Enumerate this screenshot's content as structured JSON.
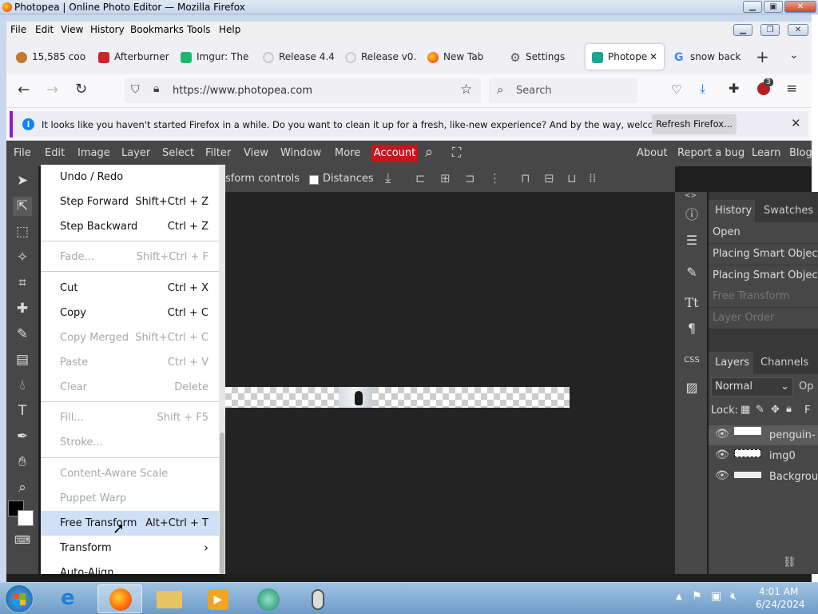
{
  "window": {
    "title": "Photopea | Online Photo Editor — Mozilla Firefox"
  },
  "firefox_menu": [
    "File",
    "Edit",
    "View",
    "History",
    "Bookmarks",
    "Tools",
    "Help"
  ],
  "tabs": [
    {
      "label": "15,585 coo",
      "icon": "cookie-icon",
      "color": "#c47a2c"
    },
    {
      "label": "Afterburner",
      "icon": "shield-icon",
      "color": "#d0212d"
    },
    {
      "label": "Imgur: The",
      "icon": "imgur-icon",
      "color": "#1bb76e"
    },
    {
      "label": "Release 4.4",
      "icon": "github-icon",
      "color": "#333333"
    },
    {
      "label": "Release v0.",
      "icon": "github-icon",
      "color": "#333333"
    },
    {
      "label": "New Tab",
      "icon": "firefox-icon",
      "color": "#ff7139"
    },
    {
      "label": "Settings",
      "icon": "gear-icon",
      "color": "#555555"
    },
    {
      "label": "Photope",
      "icon": "photopea-icon",
      "color": "#18a497"
    },
    {
      "label": "snow back",
      "icon": "google-icon",
      "color": "#4285f4"
    }
  ],
  "nav": {
    "url": "https://www.photopea.com",
    "search_placeholder": "Search",
    "badge": "3"
  },
  "notification": {
    "text": "It looks like you haven't started Firefox in a while. Do you want to clean it up for a fresh, like-new experience? And by the way, welcome back!",
    "button": "Refresh Firefox..."
  },
  "pp_menu": {
    "items": [
      "File",
      "Edit",
      "Image",
      "Layer",
      "Select",
      "Filter",
      "View",
      "Window",
      "More"
    ],
    "account": "Account",
    "right": [
      "About",
      "Report a bug",
      "Learn",
      "Blog"
    ]
  },
  "options": {
    "transform": "sform controls",
    "distances": "Distances"
  },
  "dropdown": [
    {
      "label": "Undo / Redo",
      "shortcut": "",
      "disabled": false
    },
    {
      "label": "Step Forward",
      "shortcut": "Shift+Ctrl + Z",
      "disabled": false
    },
    {
      "label": "Step Backward",
      "shortcut": "Ctrl + Z",
      "disabled": false
    },
    {
      "label": "Fade...",
      "shortcut": "Shift+Ctrl + F",
      "disabled": true
    },
    {
      "label": "Cut",
      "shortcut": "Ctrl + X",
      "disabled": false
    },
    {
      "label": "Copy",
      "shortcut": "Ctrl + C",
      "disabled": false
    },
    {
      "label": "Copy Merged",
      "shortcut": "Shift+Ctrl + C",
      "disabled": true
    },
    {
      "label": "Paste",
      "shortcut": "Ctrl + V",
      "disabled": true
    },
    {
      "label": "Clear",
      "shortcut": "Delete",
      "disabled": true
    },
    {
      "label": "Fill...",
      "shortcut": "Shift + F5",
      "disabled": true
    },
    {
      "label": "Stroke...",
      "shortcut": "",
      "disabled": true
    },
    {
      "label": "Content-Aware Scale",
      "shortcut": "",
      "disabled": true
    },
    {
      "label": "Puppet Warp",
      "shortcut": "",
      "disabled": true
    },
    {
      "label": "Free Transform",
      "shortcut": "Alt+Ctrl + T",
      "disabled": false,
      "highlighted": true
    },
    {
      "label": "Transform",
      "shortcut": "›",
      "disabled": false
    },
    {
      "label": "Auto-Align",
      "shortcut": "",
      "disabled": false
    }
  ],
  "history_panel": {
    "tabs": [
      "History",
      "Swatches"
    ],
    "items": [
      {
        "label": "Open",
        "disabled": false
      },
      {
        "label": "Placing Smart Object",
        "disabled": false
      },
      {
        "label": "Placing Smart Object",
        "disabled": false
      },
      {
        "label": "Free Transform",
        "disabled": true
      },
      {
        "label": "Layer Order",
        "disabled": true
      }
    ]
  },
  "layers_panel": {
    "tabs": [
      "Layers",
      "Channels"
    ],
    "blend_mode": "Normal",
    "opacity_label": "Op",
    "lock_label": "Lock:",
    "fill_label": "F",
    "layers": [
      "penguin-",
      "img0",
      "Backgrou"
    ]
  },
  "taskbar": {
    "time": "4:01 AM",
    "date": "6/24/2024"
  }
}
